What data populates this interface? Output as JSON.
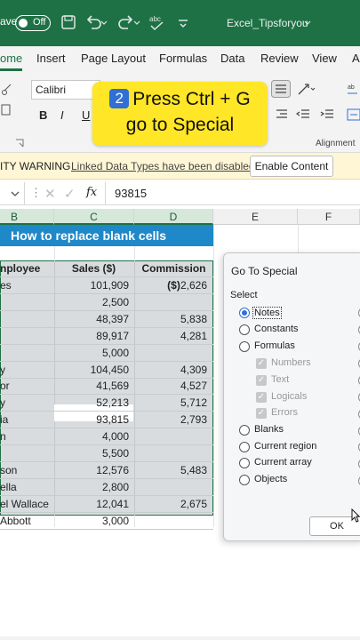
{
  "titlebar": {
    "autosave_label": "ave",
    "toggle_state": "Off",
    "doc_name": "Excel_Tipsforyou",
    "bg_color": "#1e7145"
  },
  "tabs": [
    "ome",
    "Insert",
    "Page Layout",
    "Formulas",
    "Data",
    "Review",
    "View",
    "A"
  ],
  "ribbon": {
    "font_name": "Calibri",
    "bold": "B",
    "italic": "I",
    "underline": "U",
    "alignment_label": "Alignment"
  },
  "callout": {
    "step": "2",
    "line1": "Press Ctrl + G",
    "line2": "go to Special"
  },
  "security": {
    "warning": "ITY WARNING",
    "message": "Linked Data Types have been disabled",
    "button": "Enable Content"
  },
  "formula_bar": {
    "fx": "fx",
    "value": "93815"
  },
  "columns": [
    "B",
    "C",
    "D",
    "E",
    "F"
  ],
  "sheet": {
    "title": "How to replace blank cells",
    "headers": [
      "nployee",
      "Sales ($)",
      "Commission ($)"
    ],
    "rows": [
      {
        "name": "es",
        "sales": "101,909",
        "comm": "2,626"
      },
      {
        "name": "",
        "sales": "2,500",
        "comm": ""
      },
      {
        "name": "",
        "sales": "48,397",
        "comm": "5,838"
      },
      {
        "name": "",
        "sales": "89,917",
        "comm": "4,281"
      },
      {
        "name": "",
        "sales": "5,000",
        "comm": ""
      },
      {
        "name": "y",
        "sales": "104,450",
        "comm": "4,309"
      },
      {
        "name": "or",
        "sales": "41,569",
        "comm": "4,527"
      },
      {
        "name": "y",
        "sales": "52,213",
        "comm": "5,712"
      },
      {
        "name": "ia",
        "sales": "93,815",
        "comm": "2,793"
      },
      {
        "name": "n",
        "sales": "4,000",
        "comm": ""
      },
      {
        "name": "",
        "sales": "5,500",
        "comm": ""
      },
      {
        "name": "son",
        "sales": "12,576",
        "comm": "5,483"
      },
      {
        "name": "ella",
        "sales": "2,800",
        "comm": ""
      },
      {
        "name": "el Wallace",
        "sales": "12,041",
        "comm": "2,675"
      },
      {
        "name": "Abbott",
        "sales": "3,000",
        "comm": ""
      }
    ]
  },
  "dialog": {
    "title": "Go To Special",
    "select_label": "Select",
    "options": [
      "Notes",
      "Constants",
      "Formulas"
    ],
    "sub_options": [
      "Numbers",
      "Text",
      "Logicals",
      "Errors"
    ],
    "options2": [
      "Blanks",
      "Current region",
      "Current array",
      "Objects"
    ],
    "ok": "OK"
  }
}
